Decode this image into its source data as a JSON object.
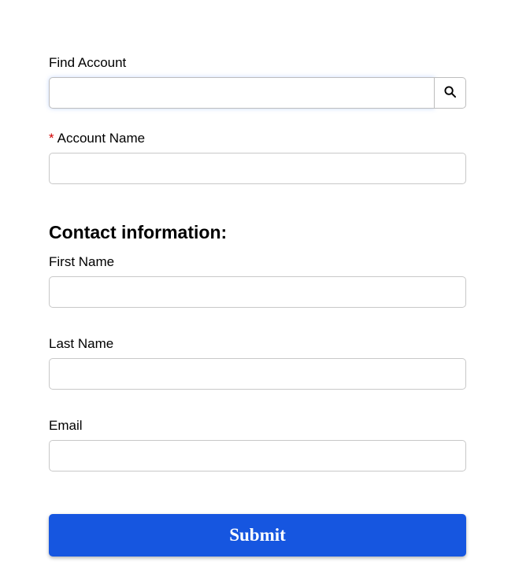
{
  "findAccount": {
    "label": "Find Account",
    "value": ""
  },
  "accountName": {
    "requiredMark": "*",
    "label": "Account Name",
    "value": ""
  },
  "contactSection": {
    "heading": "Contact information:"
  },
  "firstName": {
    "label": "First Name",
    "value": ""
  },
  "lastName": {
    "label": "Last Name",
    "value": ""
  },
  "email": {
    "label": "Email",
    "value": ""
  },
  "submit": {
    "label": "Submit"
  }
}
